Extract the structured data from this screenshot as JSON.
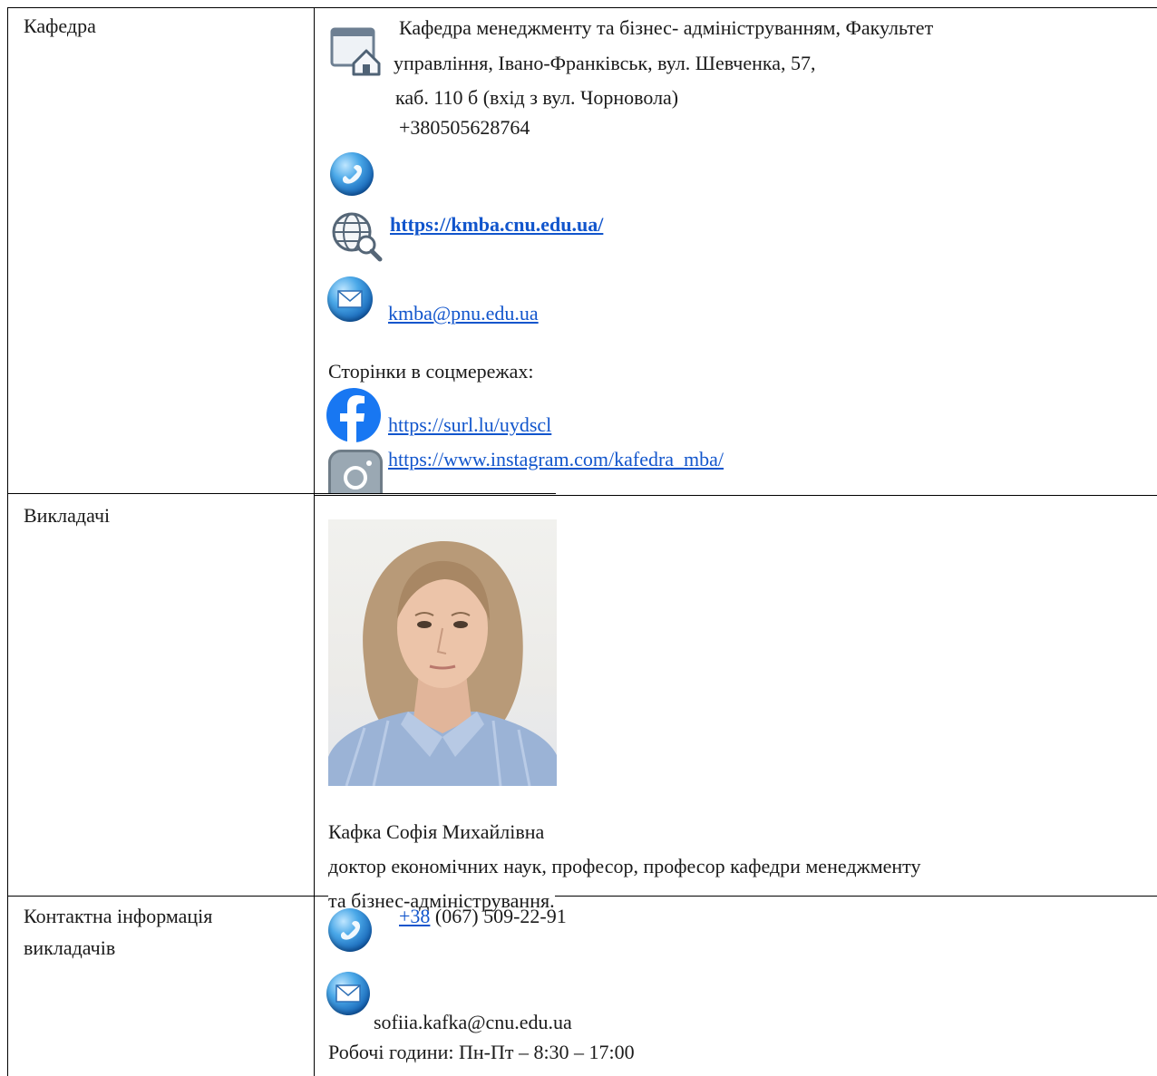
{
  "table": {
    "row1": {
      "label": "Кафедра",
      "address_lines": [
        "Кафедра менеджменту та бізнес- адмініструванням, Факультет",
        "управління, Івано-Франківськ, вул. Шевченка, 57,",
        "каб. 110 б (вхід з вул. Чорновола)",
        "+380505628764"
      ],
      "website": "https://kmba.cnu.edu.ua/",
      "email": "kmba@pnu.edu.ua",
      "social_heading": "Сторінки в соцмережах:",
      "facebook_link": "https://surl.lu/uydscl",
      "instagram_link": "https://www.instagram.com/kafedra_mba/"
    },
    "row2": {
      "label": "Викладачі",
      "name": "Кафка Софія Михайлівна",
      "title_lines": [
        "доктор економічних наук, професор, професор кафедри менеджменту",
        "та бізнес-адміністрування."
      ]
    },
    "row3": {
      "label_lines": [
        "Контактна інформація",
        "викладачів"
      ],
      "phone_prefix": "+38",
      "phone_rest": " (067) 509-22-91",
      "email": "sofiia.kafka@cnu.edu.ua",
      "hours": "Робочі години: Пн-Пт – 8:30 – 17:00"
    }
  },
  "icons": {
    "address": "building-address-icon",
    "phone": "phone-icon",
    "web": "globe-search-icon",
    "email": "envelope-icon",
    "facebook": "facebook-icon",
    "instagram": "instagram-icon"
  },
  "colors": {
    "link": "#1155cc",
    "border": "#000000",
    "facebook": "#1877f2"
  }
}
